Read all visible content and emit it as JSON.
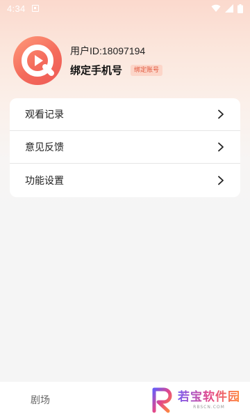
{
  "status_bar": {
    "time": "4:34",
    "icons": [
      "notification-icon",
      "wifi-icon",
      "signal-icon",
      "battery-icon"
    ]
  },
  "profile": {
    "user_id": "用户ID:18097194",
    "bind_phone": "绑定手机号",
    "bind_badge": "绑定账号"
  },
  "menu": {
    "items": [
      {
        "label": "观看记录",
        "icon": "chevron-right-icon"
      },
      {
        "label": "意见反馈",
        "icon": "chevron-right-icon"
      },
      {
        "label": "功能设置",
        "icon": "chevron-right-icon"
      }
    ]
  },
  "bottom_nav": {
    "theater": "剧场"
  },
  "watermark": {
    "text": "若宝软件园",
    "sub": "RBSCN.COM"
  },
  "colors": {
    "accent": "#f46b5c",
    "badge_bg": "#fcd5c8",
    "badge_text": "#e0563c"
  }
}
